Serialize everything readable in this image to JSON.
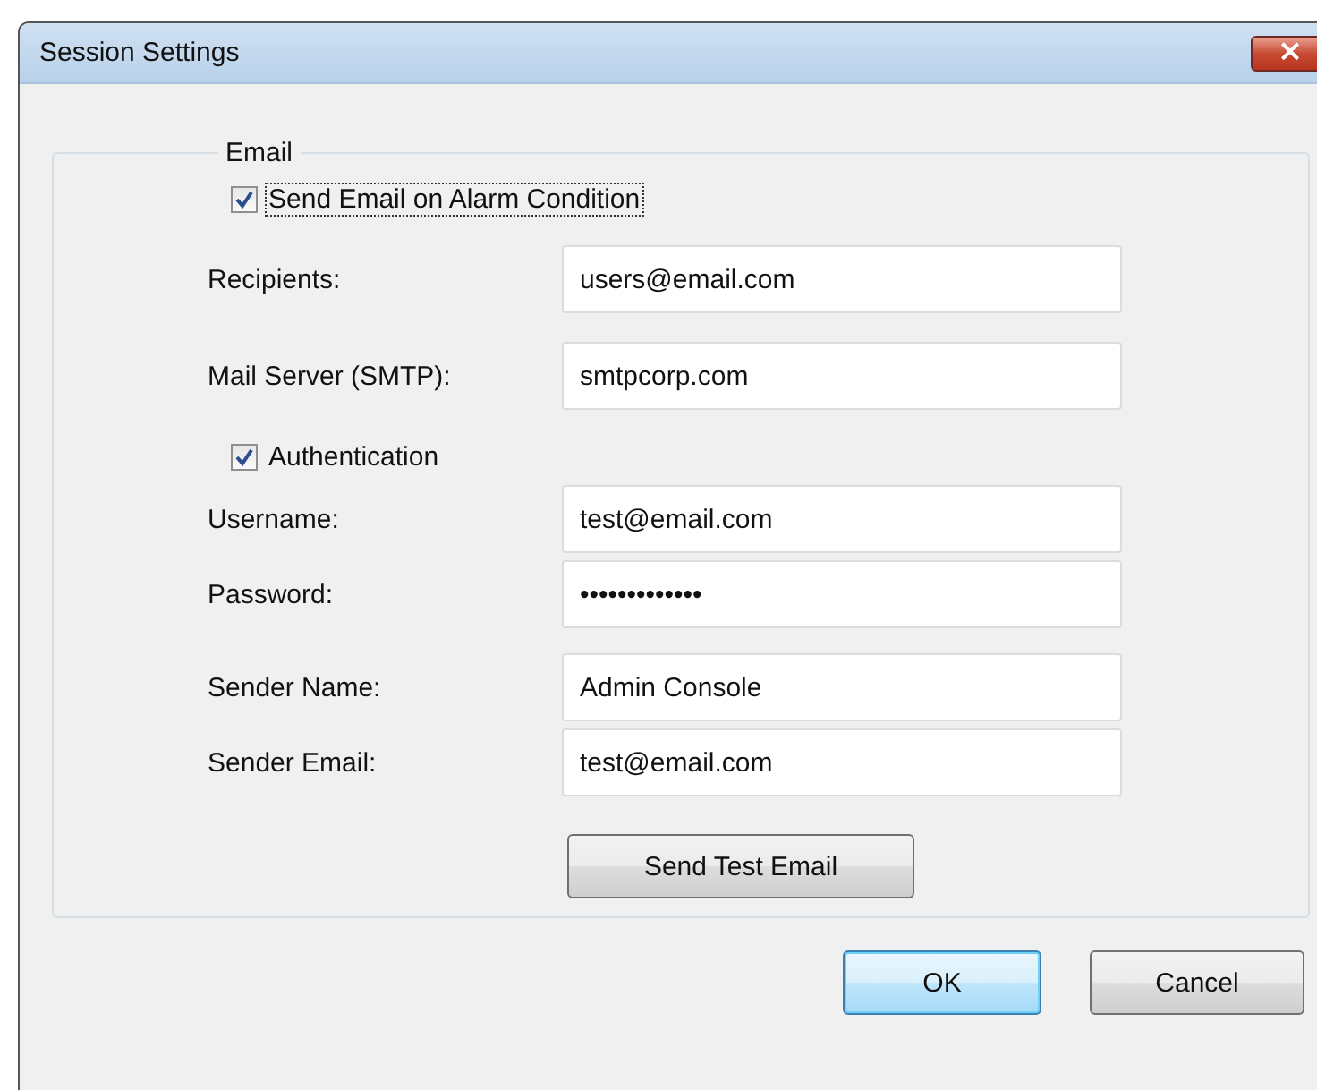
{
  "window": {
    "title": "Session Settings",
    "close": "×"
  },
  "group": {
    "title": "Email",
    "sections": [
      [
        {
          "kind": "checkbox",
          "label": "Send Email on Alarm Condition",
          "checked": true,
          "focused": true
        }
      ],
      [
        {
          "kind": "field",
          "label": "Recipients:",
          "value": "users@email.com"
        },
        {
          "kind": "field",
          "label": "Mail Server (SMTP):",
          "value": "smtpcorp.com"
        }
      ],
      [
        {
          "kind": "checkbox",
          "label": "Authentication",
          "checked": true,
          "focused": false
        },
        {
          "kind": "field",
          "label": "Username:",
          "value": "test@email.com"
        },
        {
          "kind": "field",
          "label": "Password:",
          "value": "•••••••••••••"
        }
      ],
      [
        {
          "kind": "field",
          "label": "Sender Name:",
          "value": "Admin Console"
        },
        {
          "kind": "field",
          "label": "Sender Email:",
          "value": "test@email.com"
        }
      ],
      [
        {
          "kind": "button",
          "label": "Send Test Email"
        }
      ]
    ]
  },
  "buttons": [
    {
      "label": "OK",
      "default": true
    },
    {
      "label": "Cancel",
      "default": false
    }
  ]
}
